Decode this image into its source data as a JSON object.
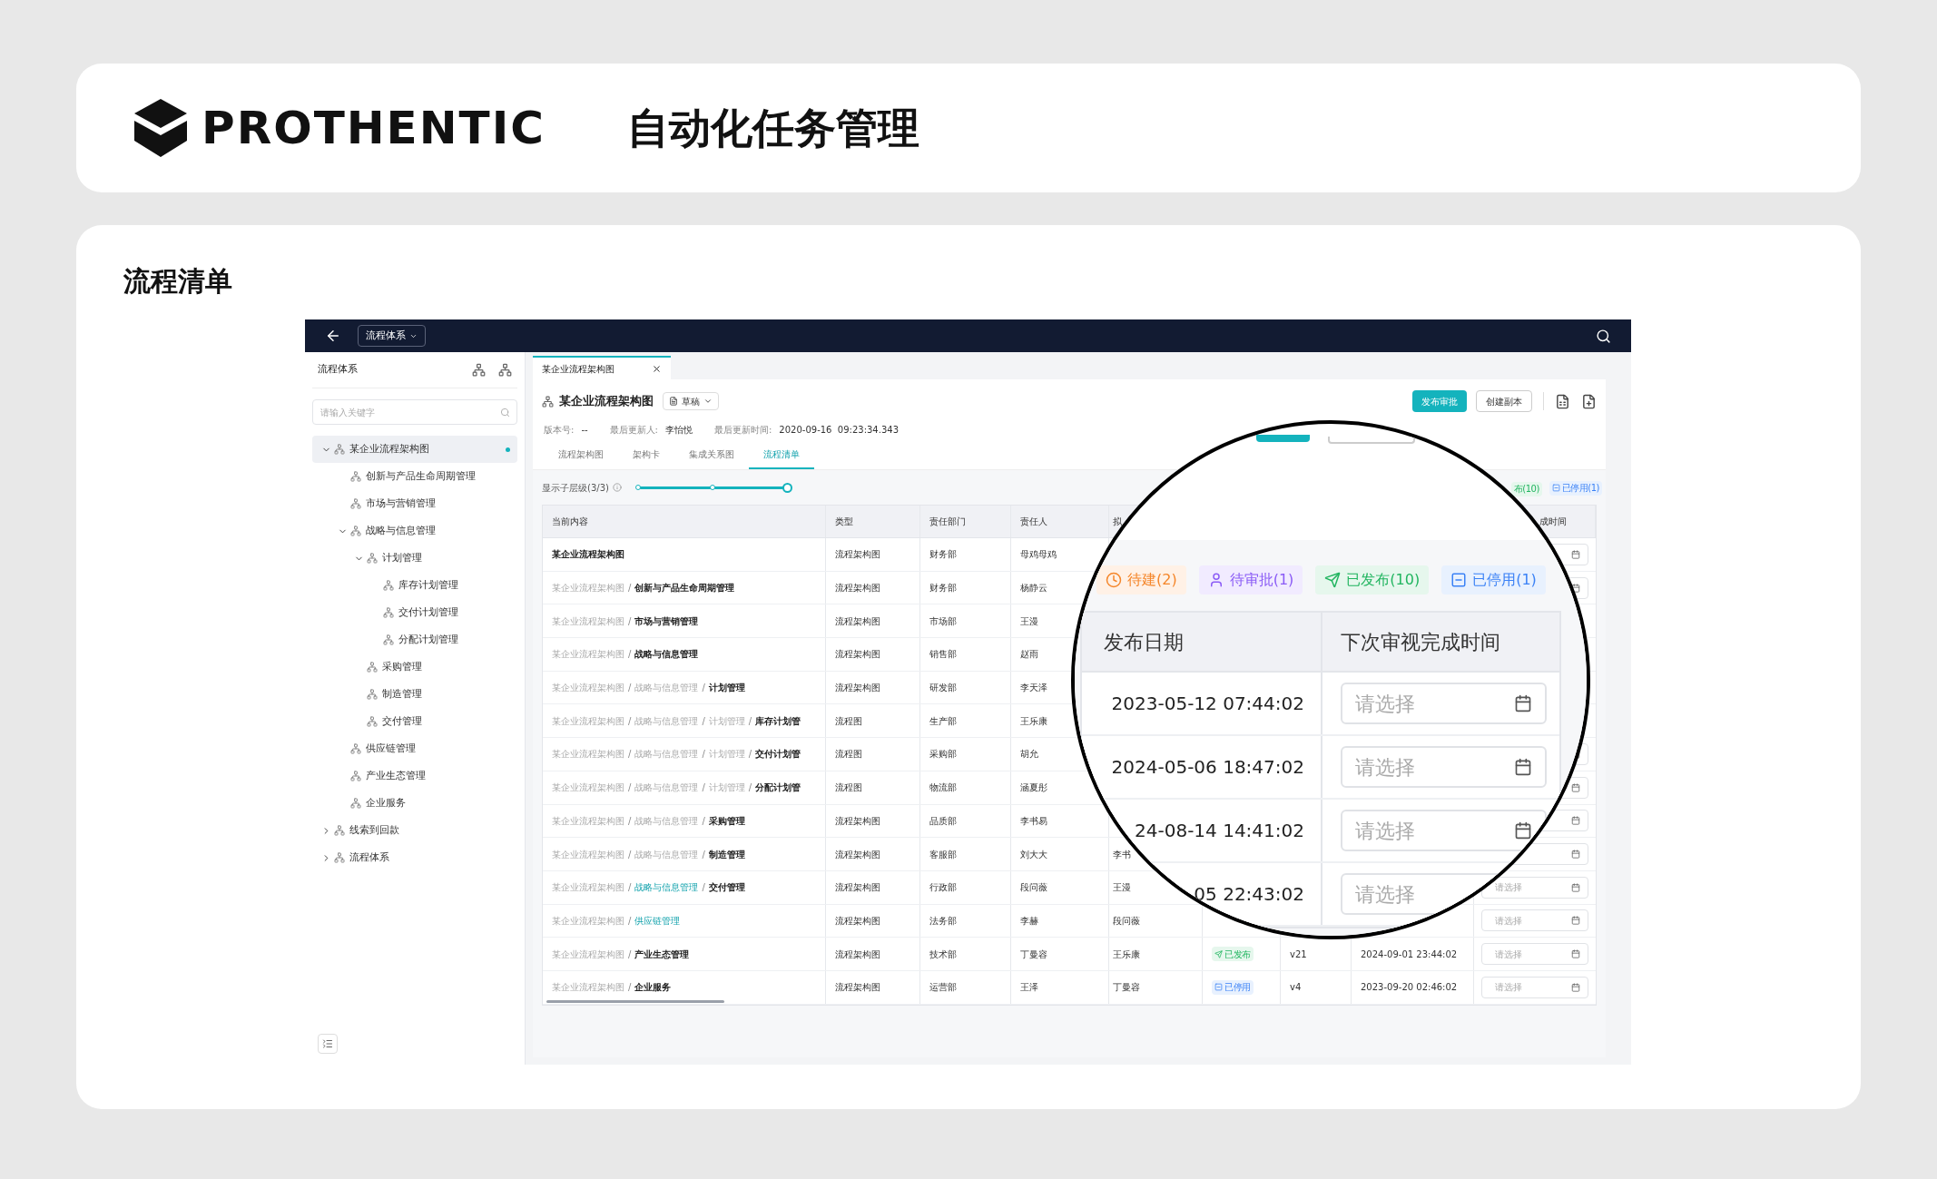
{
  "header": {
    "brand": "PROTHENTIC",
    "title": "自动化任务管理"
  },
  "section_title": "流程清单",
  "app": {
    "topbar": {
      "dropdown": "流程体系"
    },
    "sidebar": {
      "title": "流程体系",
      "search": {
        "placeholder": "请输入关键字"
      },
      "tree": [
        {
          "label": "某企业流程架构图",
          "selected": true,
          "expanded": true,
          "children": [
            {
              "label": "创新与产品生命周期管理",
              "selected": false
            },
            {
              "label": "市场与营销管理",
              "selected": false
            },
            {
              "label": "战略与信息管理",
              "selected": false,
              "expanded": true,
              "children": [
                {
                  "label": "计划管理",
                  "selected": false,
                  "expanded": true,
                  "children": [
                    {
                      "label": "库存计划管理",
                      "selected": false
                    },
                    {
                      "label": "交付计划管理",
                      "selected": false
                    },
                    {
                      "label": "分配计划管理",
                      "selected": false
                    }
                  ]
                },
                {
                  "label": "采购管理",
                  "selected": false
                },
                {
                  "label": "制造管理",
                  "selected": false
                },
                {
                  "label": "交付管理",
                  "selected": false
                }
              ]
            },
            {
              "label": "供应链管理",
              "selected": false
            },
            {
              "label": "产业生态管理",
              "selected": false
            },
            {
              "label": "企业服务",
              "selected": false
            }
          ]
        },
        {
          "label": "线索到回款",
          "selected": false,
          "expanded": false
        },
        {
          "label": "流程体系",
          "selected": false,
          "expanded": false
        }
      ]
    },
    "tabs": [
      {
        "label": "某企业流程架构图",
        "selected": true
      }
    ],
    "doc": {
      "title": "某企业流程架构图",
      "status": "草稿",
      "meta": [
        {
          "label": "版本号:",
          "value": "--"
        },
        {
          "label": "最后更新人:",
          "value": "李怡悦"
        },
        {
          "label": "最后更新时间:",
          "value": "2020-09-16  09:23:34.343"
        }
      ],
      "actions": [
        {
          "label": "发布审批",
          "kind": "primary"
        },
        {
          "label": "创建副本",
          "kind": "secondary"
        }
      ]
    },
    "view_tabs": [
      {
        "label": "流程架构图",
        "selected": false
      },
      {
        "label": "架构卡",
        "selected": false
      },
      {
        "label": "集成关系图",
        "selected": false
      },
      {
        "label": "流程清单",
        "selected": true
      }
    ],
    "depth": {
      "label": "显示子层级(3/3)",
      "level": 1
    },
    "filters": [
      {
        "label": "布(10)",
        "kind": "published",
        "icon": false
      },
      {
        "label": "已停用(1)",
        "kind": "disabled",
        "icon": true
      }
    ],
    "table": {
      "separator": "/",
      "columns": [
        "当前内容",
        "类型",
        "责任部门",
        "责任人",
        "拟"
      ],
      "last_column": "成时间",
      "rows": [
        {
          "path": [
            {
              "text": "某企业流程架构图",
              "kind": "current"
            }
          ],
          "type": "流程架构图",
          "dept": "财务部",
          "owner": "母鸡母鸡",
          "next_review": {
            "calendar_icon": true
          }
        },
        {
          "path": [
            {
              "text": "某企业流程架构图",
              "kind": "ancestor"
            },
            {
              "text": "创新与产品生命周期管理",
              "kind": "current"
            }
          ],
          "type": "流程架构图",
          "dept": "财务部",
          "owner": "杨静云",
          "next_review": {
            "calendar_icon": true
          }
        },
        {
          "path": [
            {
              "text": "某企业流程架构图",
              "kind": "ancestor"
            },
            {
              "text": "市场与营销管理",
              "kind": "current"
            }
          ],
          "type": "流程架构图",
          "dept": "市场部",
          "owner": "王漫"
        },
        {
          "path": [
            {
              "text": "某企业流程架构图",
              "kind": "ancestor"
            },
            {
              "text": "战略与信息管理",
              "kind": "current"
            }
          ],
          "type": "流程架构图",
          "dept": "销售部",
          "owner": "赵雨"
        },
        {
          "path": [
            {
              "text": "某企业流程架构图",
              "kind": "ancestor"
            },
            {
              "text": "战略与信息管理",
              "kind": "ancestor"
            },
            {
              "text": "计划管理",
              "kind": "current"
            }
          ],
          "type": "流程架构图",
          "dept": "研发部",
          "owner": "李天泽"
        },
        {
          "path": [
            {
              "text": "某企业流程架构图",
              "kind": "ancestor"
            },
            {
              "text": "战略与信息管理",
              "kind": "ancestor"
            },
            {
              "text": "计划管理",
              "kind": "ancestor"
            },
            {
              "text": "库存计划管",
              "kind": "current"
            }
          ],
          "type": "流程图",
          "dept": "生产部",
          "owner": "王乐康"
        },
        {
          "path": [
            {
              "text": "某企业流程架构图",
              "kind": "ancestor"
            },
            {
              "text": "战略与信息管理",
              "kind": "ancestor"
            },
            {
              "text": "计划管理",
              "kind": "ancestor"
            },
            {
              "text": "交付计划管",
              "kind": "current"
            }
          ],
          "type": "流程图",
          "dept": "采购部",
          "owner": "胡允",
          "next_review": {
            "calendar_icon": true
          }
        },
        {
          "path": [
            {
              "text": "某企业流程架构图",
              "kind": "ancestor"
            },
            {
              "text": "战略与信息管理",
              "kind": "ancestor"
            },
            {
              "text": "计划管理",
              "kind": "ancestor"
            },
            {
              "text": "分配计划管",
              "kind": "current"
            }
          ],
          "type": "流程图",
          "dept": "物流部",
          "owner": "涵夏彤",
          "next_review": {
            "calendar_icon": true
          }
        },
        {
          "path": [
            {
              "text": "某企业流程架构图",
              "kind": "ancestor"
            },
            {
              "text": "战略与信息管理",
              "kind": "ancestor"
            },
            {
              "text": "采购管理",
              "kind": "current"
            }
          ],
          "type": "流程架构图",
          "dept": "品质部",
          "owner": "李书易",
          "next_review": {
            "calendar_icon": true
          }
        },
        {
          "path": [
            {
              "text": "某企业流程架构图",
              "kind": "ancestor"
            },
            {
              "text": "战略与信息管理",
              "kind": "ancestor"
            },
            {
              "text": "制造管理",
              "kind": "current"
            }
          ],
          "type": "流程架构图",
          "dept": "客服部",
          "owner": "刘大大",
          "drafter": "李书",
          "next_review": {
            "calendar_icon": true
          }
        },
        {
          "path": [
            {
              "text": "某企业流程架构图",
              "kind": "ancestor"
            },
            {
              "text": "战略与信息管理",
              "kind": "link"
            },
            {
              "text": "交付管理",
              "kind": "current"
            }
          ],
          "type": "流程架构图",
          "dept": "行政部",
          "owner": "段问薇",
          "drafter": "王漫",
          "next_review": {
            "placeholder": "请选择",
            "calendar_icon": true
          }
        },
        {
          "path": [
            {
              "text": "某企业流程架构图",
              "kind": "ancestor"
            },
            {
              "text": "供应链管理",
              "kind": "link"
            }
          ],
          "type": "流程架构图",
          "dept": "法务部",
          "owner": "李赫",
          "drafter": "段问薇",
          "next_review": {
            "placeholder": "请选择",
            "calendar_icon": true
          }
        },
        {
          "path": [
            {
              "text": "某企业流程架构图",
              "kind": "ancestor"
            },
            {
              "text": "产业生态管理",
              "kind": "current"
            }
          ],
          "type": "流程架构图",
          "dept": "技术部",
          "owner": "丁曼容",
          "drafter": "王乐康",
          "status": {
            "label": "已发布",
            "kind": "published"
          },
          "version": "v21",
          "date": "2024-09-01 23:44:02",
          "next_review": {
            "placeholder": "请选择",
            "calendar_icon": true
          }
        },
        {
          "path": [
            {
              "text": "某企业流程架构图",
              "kind": "ancestor"
            },
            {
              "text": "企业服务",
              "kind": "current"
            }
          ],
          "type": "流程架构图",
          "dept": "运营部",
          "owner": "王泽",
          "drafter": "丁曼容",
          "status": {
            "label": "已停用",
            "kind": "disabled"
          },
          "version": "v4",
          "date": "2023-09-20 02:46:02",
          "next_review": {
            "placeholder": "请选择",
            "calendar_icon": true
          }
        }
      ]
    }
  },
  "magnifier": {
    "filters": [
      {
        "label": "待建(2)",
        "kind": "pending"
      },
      {
        "label": "待审批(1)",
        "kind": "review"
      },
      {
        "label": "已发布(10)",
        "kind": "published"
      },
      {
        "label": "已停用(1)",
        "kind": "disabled"
      }
    ],
    "columns": [
      "发布日期",
      "下次审视完成时间"
    ],
    "rows": [
      {
        "date": "2023-05-12 07:44:02",
        "placeholder": "请选择",
        "calendar_icon": true
      },
      {
        "date": "2024-05-06 18:47:02",
        "placeholder": "请选择",
        "calendar_icon": true
      },
      {
        "date": "24-08-14 14:41:02",
        "placeholder": "请选择",
        "calendar_icon": true
      },
      {
        "date": "05 22:43:02",
        "placeholder": "请选择"
      }
    ]
  }
}
